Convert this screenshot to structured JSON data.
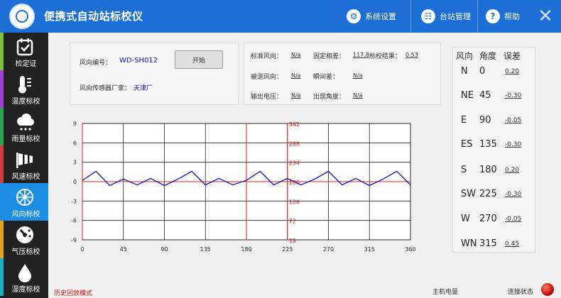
{
  "header": {
    "title": "便携式自动站标校仪",
    "system_settings": "系统设置",
    "station_management": "台站管理",
    "help": "帮助",
    "system_icon": "gear-icon",
    "station_icon": "station-icon",
    "help_icon": "question-icon",
    "close_icon": "close-icon",
    "accent_color": "#1c6fd6"
  },
  "sidebar": {
    "items": [
      {
        "label": "检定证",
        "icon": "certificate-icon",
        "color": "#7fbf3f"
      },
      {
        "label": "温度标校",
        "icon": "thermometer-icon",
        "color": "#a43fd0"
      },
      {
        "label": "雨量标校",
        "icon": "rain-cloud-icon",
        "color": "#2ba34a"
      },
      {
        "label": "风速标校",
        "icon": "windsock-icon",
        "color": "#d23c3c"
      },
      {
        "label": "风向标校",
        "icon": "wind-direction-icon",
        "color": "#1c8ee6"
      },
      {
        "label": "气压标校",
        "icon": "gauge-icon",
        "color": "#e6a21c"
      },
      {
        "label": "湿度标校",
        "icon": "humidity-drop-icon",
        "color": "#16b0c4"
      }
    ]
  },
  "info": {
    "dir_id_label": "风向编号：",
    "dir_id_value": "WD-SH012",
    "maker_label": "风向传感器厂家：",
    "maker_value": "天津厂",
    "start_button": "开始"
  },
  "readings": {
    "std_dir_label": "标准风向：",
    "std_dir_value": "N/a",
    "fixed_diff_label": "固定相差：",
    "fixed_diff_value": "117.8",
    "calib_result_label": "标校结果：",
    "calib_result_value": "0.53",
    "measured_label": "被测风向：",
    "measured_value": "N/a",
    "instant_diff_label": "瞬间差：",
    "instant_diff_value": "N/a",
    "voltage_label": "输出电压：",
    "voltage_value": "N/a",
    "angle_label": "出现角度：",
    "angle_value": "N/a"
  },
  "table": {
    "headers": [
      "风向",
      "角度",
      "误差"
    ],
    "rows": [
      {
        "dir": "N",
        "angle": "0",
        "error": "0.20"
      },
      {
        "dir": "NE",
        "angle": "45",
        "error": "-0.30"
      },
      {
        "dir": "E",
        "angle": "90",
        "error": "-0.05"
      },
      {
        "dir": "ES",
        "angle": "135",
        "error": "-0.30"
      },
      {
        "dir": "S",
        "angle": "180",
        "error": "0.20"
      },
      {
        "dir": "SW",
        "angle": "225",
        "error": "-0.30"
      },
      {
        "dir": "W",
        "angle": "270",
        "error": "-0.05"
      },
      {
        "dir": "WN",
        "angle": "315",
        "error": "0.45"
      }
    ]
  },
  "footer": {
    "playback_mode": "历史回放模式",
    "host_battery": "主机电量",
    "connection_status": "连接状态",
    "status_color": "#d01010"
  },
  "chart_data": {
    "type": "line",
    "x": [
      0,
      15,
      30,
      45,
      60,
      75,
      90,
      105,
      120,
      135,
      150,
      165,
      180,
      195,
      210,
      225,
      240,
      255,
      270,
      285,
      300,
      315,
      330,
      345,
      360
    ],
    "series": [
      {
        "values": [
          0.2,
          1.6,
          -0.6,
          0.4,
          -0.5,
          0.5,
          -0.6,
          0.4,
          1.6,
          -0.5,
          0.5,
          -0.5,
          0.2,
          1.6,
          -0.5,
          0.5,
          -0.5,
          0.4,
          1.6,
          -0.5,
          0.5,
          -0.6,
          0.4,
          1.6,
          -0.5
        ],
        "color": "#1414b4"
      }
    ],
    "xticks": [
      0,
      45,
      90,
      135,
      180,
      225,
      270,
      315,
      360
    ],
    "yticks_left": [
      9,
      6,
      3,
      0,
      -3,
      -6,
      -9
    ],
    "yticks_right": [
      342,
      288,
      234,
      180,
      126,
      72,
      18
    ],
    "xlim": [
      0,
      360
    ],
    "ylim": [
      -9,
      9
    ],
    "red_vertical_lines": [
      0,
      180,
      225
    ],
    "red_horizontal_line": 0,
    "grid": true,
    "xlabel": "",
    "ylabel": "",
    "title": ""
  }
}
